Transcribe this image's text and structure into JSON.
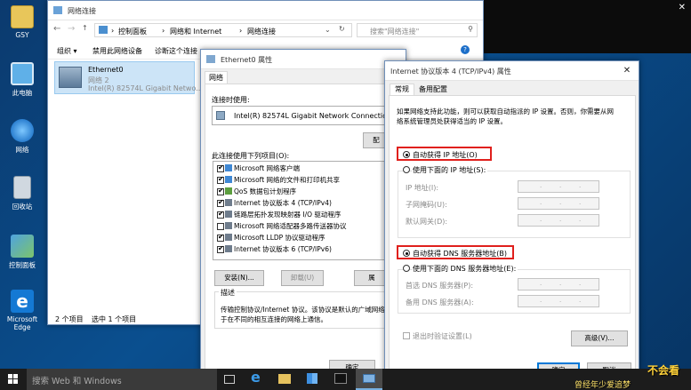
{
  "desktop": {
    "icons": [
      {
        "label": "GSY"
      },
      {
        "label": "此电脑"
      },
      {
        "label": "网络"
      },
      {
        "label": "回收站"
      },
      {
        "label": "控制面板"
      },
      {
        "label": "Microsoft Edge"
      }
    ]
  },
  "netwin": {
    "title": "网络连接",
    "breadcrumb": [
      "控制面板",
      "网络和 Internet",
      "网络连接"
    ],
    "search_placeholder": "搜索\"网络连接\"",
    "toolbar": {
      "organize": "组织 ▾",
      "disable": "禁用此网络设备",
      "diagnose": "诊断这个连接"
    },
    "adapter": {
      "name": "Ethernet0",
      "network": "网络 2",
      "device": "Intel(R) 82574L Gigabit Netwo..."
    },
    "status": {
      "count": "2 个项目",
      "selected": "选中 1 个项目"
    }
  },
  "propwin": {
    "title": "Ethernet0 属性",
    "tab": "网络",
    "connect_using": "连接时使用:",
    "adapter": "Intel(R) 82574L Gigabit Network Connection",
    "configure": "配",
    "items_label": "此连接使用下列项目(O):",
    "items": [
      {
        "label": "Microsoft 网络客户端",
        "checked": true
      },
      {
        "label": "Microsoft 网络的文件和打印机共享",
        "checked": true
      },
      {
        "label": "QoS 数据包计划程序",
        "checked": true
      },
      {
        "label": "Internet 协议版本 4 (TCP/IPv4)",
        "checked": true
      },
      {
        "label": "链路层拓扑发现映射器 I/O 驱动程序",
        "checked": true
      },
      {
        "label": "Microsoft 网络适配器多路传送器协议",
        "checked": false
      },
      {
        "label": "Microsoft LLDP 协议驱动程序",
        "checked": true
      },
      {
        "label": "Internet 协议版本 6 (TCP/IPv6)",
        "checked": true
      }
    ],
    "install": "安装(N)...",
    "uninstall": "卸载(U)",
    "properties": "属",
    "desc_label": "描述",
    "desc_line1": "传输控制协议/Internet 协议。该协议是默认的广域网络",
    "desc_line2": "于在不同的相互连接的网络上通信。",
    "ok": "确定"
  },
  "ipv4": {
    "title": "Internet 协议版本 4 (TCP/IPv4) 属性",
    "tabs": [
      "常规",
      "备用配置"
    ],
    "intro_line1": "如果网络支持此功能，则可以获取自动指派的 IP 设置。否则，你需要从网",
    "intro_line2": "络系统管理员处获得适当的 IP 设置。",
    "auto_ip": "自动获得 IP 地址(O)",
    "manual_ip": "使用下面的 IP 地址(S):",
    "ip_fields": [
      {
        "label": "IP 地址(I):"
      },
      {
        "label": "子网掩码(U):"
      },
      {
        "label": "默认网关(D):"
      }
    ],
    "auto_dns": "自动获得 DNS 服务器地址(B)",
    "manual_dns": "使用下面的 DNS 服务器地址(E):",
    "dns_fields": [
      {
        "label": "首选 DNS 服务器(P):"
      },
      {
        "label": "备用 DNS 服务器(A):"
      }
    ],
    "validate": "退出时验证设置(L)",
    "advanced": "高级(V)...",
    "ok": "确定",
    "cancel": "取消"
  },
  "taskbar": {
    "search_placeholder": "搜索 Web 和 Windows"
  },
  "watermark": {
    "line1": "不会看",
    "line2": "曾经年少爱追梦"
  },
  "colors": {
    "highlight": "#e0201c",
    "taskbar": "#1c1c1c",
    "selection": "#cce4f7"
  }
}
